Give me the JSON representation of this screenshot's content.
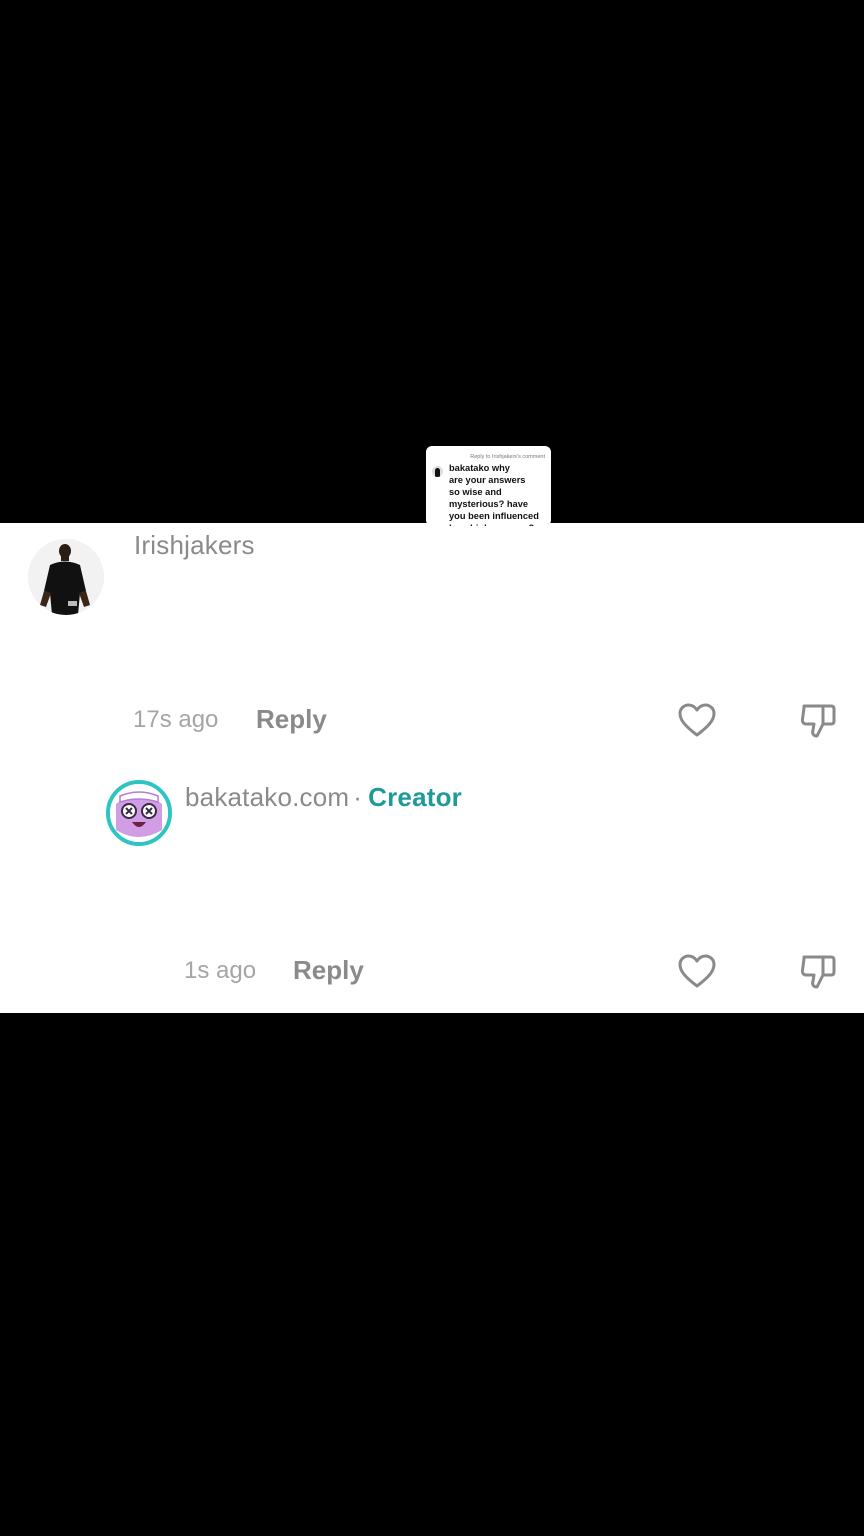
{
  "sticker": {
    "header": "Reply to Irishjakers's comment",
    "text": "bakatako why\nare your answers\nso wise and\nmysterious? have\nyou been influenced\nby a higher power?"
  },
  "comments": [
    {
      "username": "Irishjakers",
      "time": "17s ago",
      "reply_label": "Reply"
    },
    {
      "username": "bakatako.com",
      "separator": "·",
      "badge": "Creator",
      "time": "1s ago",
      "reply_label": "Reply"
    }
  ],
  "icons": {
    "like": "heart-outline-icon",
    "dislike": "thumbs-down-outline-icon"
  },
  "colors": {
    "background": "#000000",
    "panel": "#ffffff",
    "creator_accent": "#1f9a9a",
    "avatar_ring": "#2ec4c4"
  }
}
